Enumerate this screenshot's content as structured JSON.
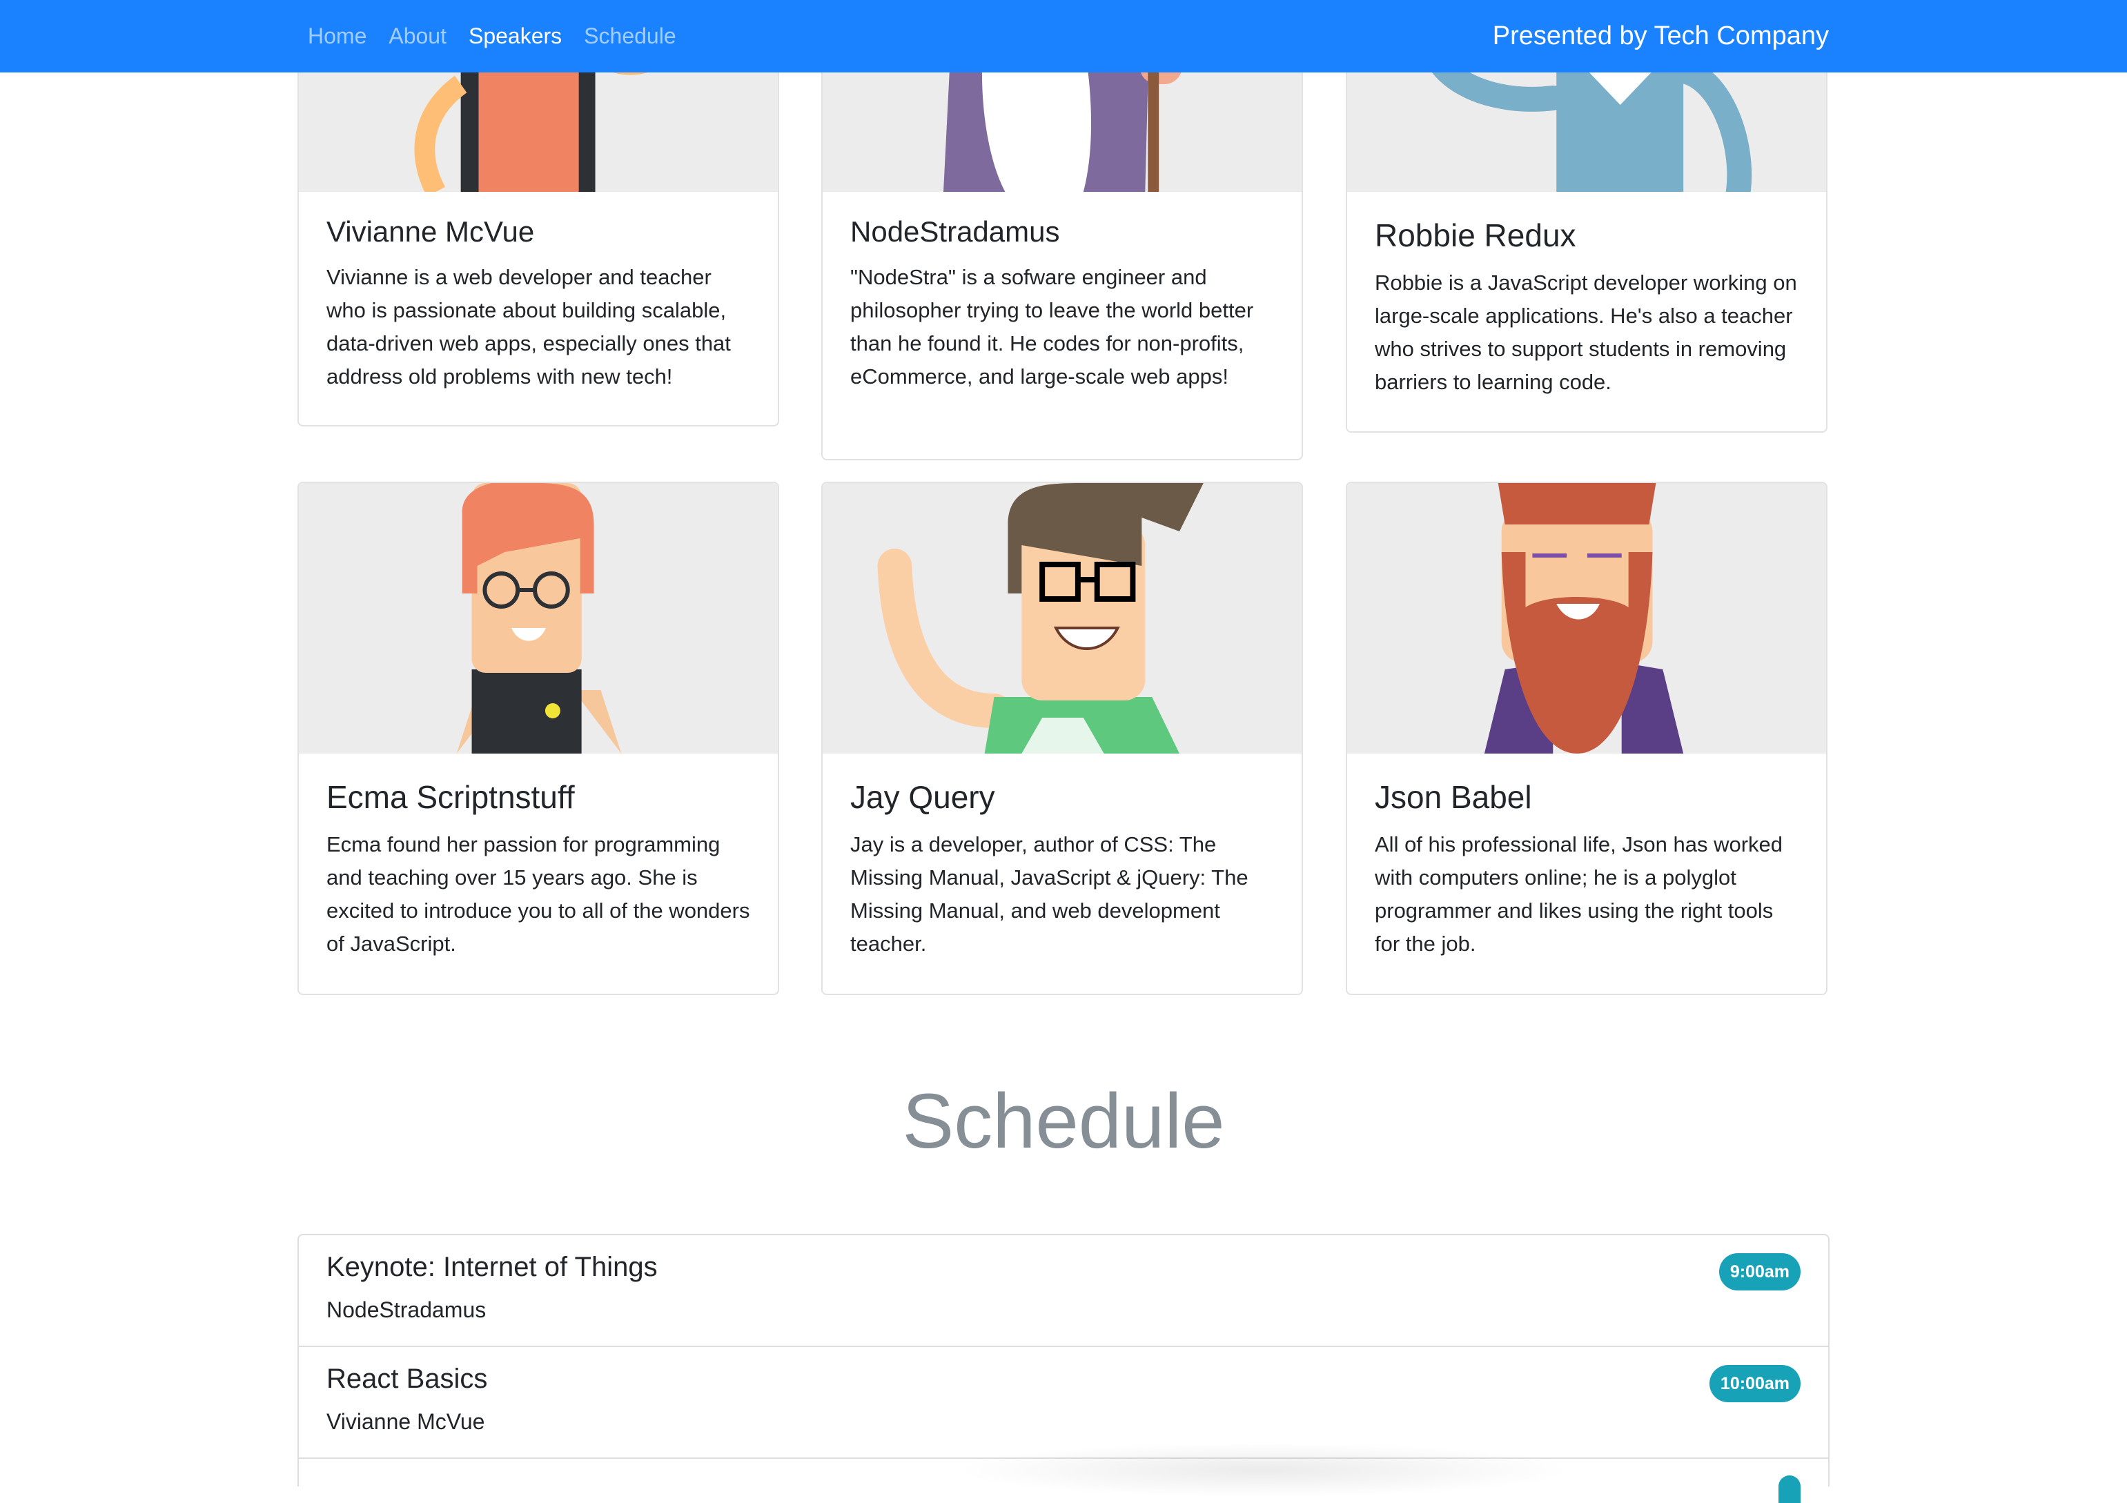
{
  "nav": {
    "links": [
      "Home",
      "About",
      "Speakers",
      "Schedule"
    ],
    "active": "Speakers",
    "brand": "Presented by Tech Company"
  },
  "speakers": [
    {
      "name": "Vivianne McVue",
      "bio": "Vivianne is a web developer and teacher who is passionate about building scalable, data-driven web apps, especially ones that address old problems with new tech!",
      "avatar": "vivianne-avatar"
    },
    {
      "name": "NodeStradamus",
      "bio": "\"NodeStra\" is a sofware engineer and philosopher trying to leave the world better than he found it. He codes for non-profits, eCommerce, and large-scale web apps!",
      "avatar": "nodestradamus-avatar"
    },
    {
      "name": "Robbie Redux",
      "bio": "Robbie is a JavaScript developer working on large-scale applications. He's also a teacher who strives to support students in removing barriers to learning code.",
      "avatar": "robbie-avatar"
    },
    {
      "name": "Ecma Scriptnstuff",
      "bio": "Ecma found her passion for programming and teaching over 15 years ago. She is excited to introduce you to all of the wonders of JavaScript.",
      "avatar": "ecma-avatar"
    },
    {
      "name": "Jay Query",
      "bio": "Jay is a developer, author of CSS: The Missing Manual, JavaScript & jQuery: The Missing Manual, and web development teacher.",
      "avatar": "jay-avatar"
    },
    {
      "name": "Json Babel",
      "bio": "All of his professional life, Json has worked with computers online; he is a polyglot programmer and likes using the right tools for the job.",
      "avatar": "json-avatar"
    }
  ],
  "schedule": {
    "heading": "Schedule",
    "sessions": [
      {
        "title": "Keynote: Internet of Things",
        "speaker": "NodeStradamus",
        "time": "9:00am"
      },
      {
        "title": "React Basics",
        "speaker": "Vivianne McVue",
        "time": "10:00am"
      }
    ]
  },
  "colors": {
    "navbar": "#1a82ff",
    "badge": "#17a2b8",
    "card_image_bg": "#ececec",
    "heading_gray": "#868e96"
  }
}
